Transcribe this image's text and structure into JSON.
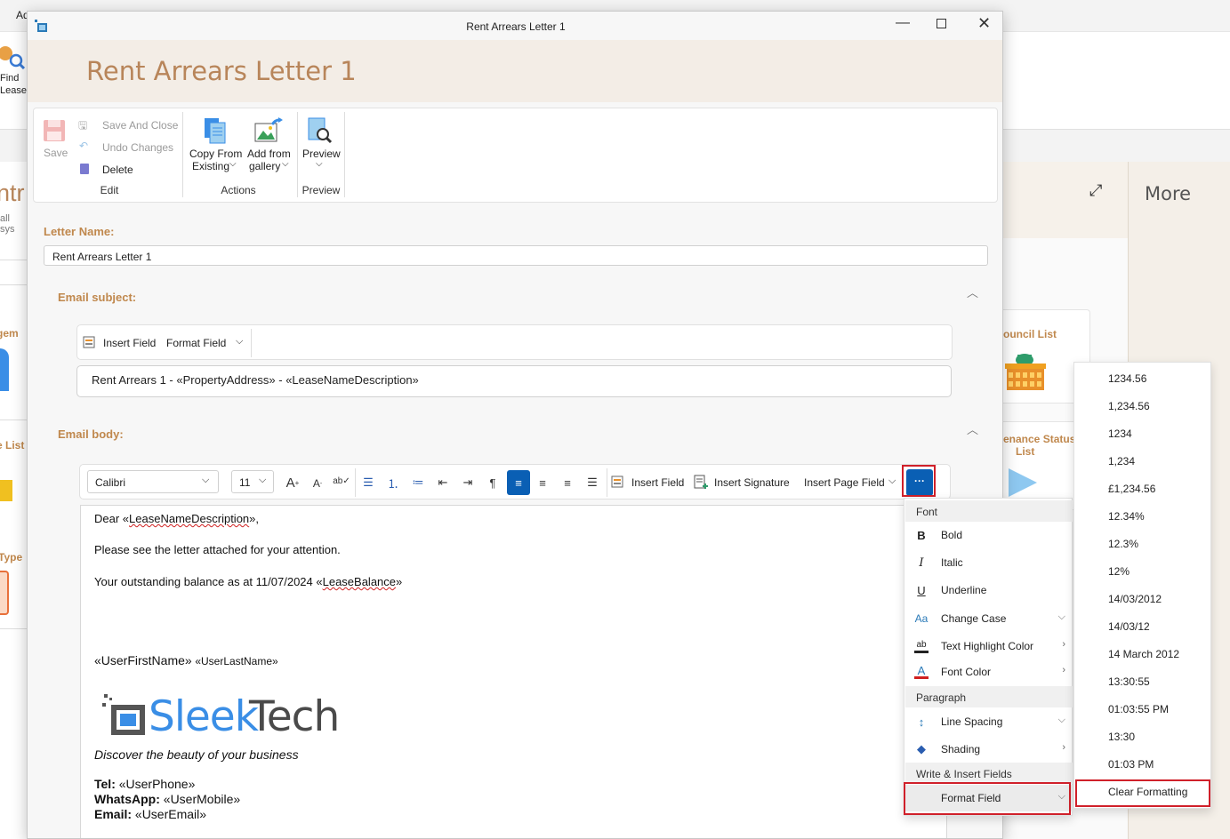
{
  "background_app": {
    "topbar_text": "Ad",
    "find_lease": {
      "line1": "Find",
      "line2": "Lease"
    },
    "left_fragments": [
      "ntr",
      "all sys",
      "gem",
      "e List",
      "Type"
    ],
    "more_label": "More",
    "council_list": "ouncil List",
    "maintenance_status": {
      "line1": "enance Status",
      "line2": "List"
    }
  },
  "dialog": {
    "window_title": "Rent Arrears Letter 1",
    "header_title": "Rent Arrears Letter 1",
    "ribbon": {
      "save": "Save",
      "save_and_close": "Save And Close",
      "undo_changes": "Undo Changes",
      "delete": "Delete",
      "edit_group": "Edit",
      "copy_from": {
        "line1": "Copy From",
        "line2": "Existing"
      },
      "add_from": {
        "line1": "Add from",
        "line2": "gallery"
      },
      "actions_group": "Actions",
      "preview": "Preview",
      "preview_group": "Preview"
    },
    "letter_name_label": "Letter Name:",
    "letter_name_value": "Rent Arrears Letter 1",
    "email_subject_label": "Email subject:",
    "subject_toolbar": {
      "insert_field": "Insert Field",
      "format_field": "Format Field"
    },
    "subject_value": "Rent Arrears 1 - «PropertyAddress»  - «LeaseNameDescription»",
    "email_body_label": "Email body:",
    "body_toolbar": {
      "font": "Calibri",
      "size": "11",
      "insert_field": "Insert Field",
      "insert_signature": "Insert Signature",
      "insert_page_field": "Insert Page Field",
      "more": "···"
    },
    "body": {
      "dear_prefix": "Dear «",
      "dear_field": "LeaseNameDescription",
      "dear_suffix": "»,",
      "line2": "Please see the letter attached for your attention.",
      "line3_prefix": "Your outstanding balance as at  11/07/2024 «",
      "line3_field": "LeaseBalance",
      "line3_suffix": "»",
      "first_name": "«UserFirstName»",
      "last_name": "«UserLastName»",
      "logo_sleek": "Sleek",
      "logo_tech": "Tech",
      "tagline": "Discover the beauty of your business",
      "tel_label": "Tel:",
      "tel_value": " «UserPhone»",
      "whatsapp_label": "WhatsApp:",
      "whatsapp_value": " «UserMobile»",
      "email_label": "Email:",
      "email_value": " «UserEmail»"
    }
  },
  "menu": {
    "font_section": "Font",
    "bold": "Bold",
    "italic": "Italic",
    "underline": "Underline",
    "change_case": "Change Case",
    "text_highlight": "Text Highlight Color",
    "font_color": "Font Color",
    "paragraph_section": "Paragraph",
    "line_spacing": "Line Spacing",
    "shading": "Shading",
    "write_insert_section": "Write & Insert Fields",
    "format_field": "Format Field"
  },
  "submenu": {
    "items": [
      "1234.56",
      "1,234.56",
      "1234",
      "1,234",
      "£1,234.56",
      "12.34%",
      "12.3%",
      "12%",
      "14/03/2012",
      "14/03/12",
      "14 March 2012",
      "13:30:55",
      "01:03:55 PM",
      "13:30",
      "01:03 PM",
      "Clear Formatting"
    ]
  },
  "colors": {
    "accent": "#c0884d",
    "title": "#b8855a",
    "highlight_box": "#d0202a",
    "selected_button": "#0a5fb4"
  }
}
